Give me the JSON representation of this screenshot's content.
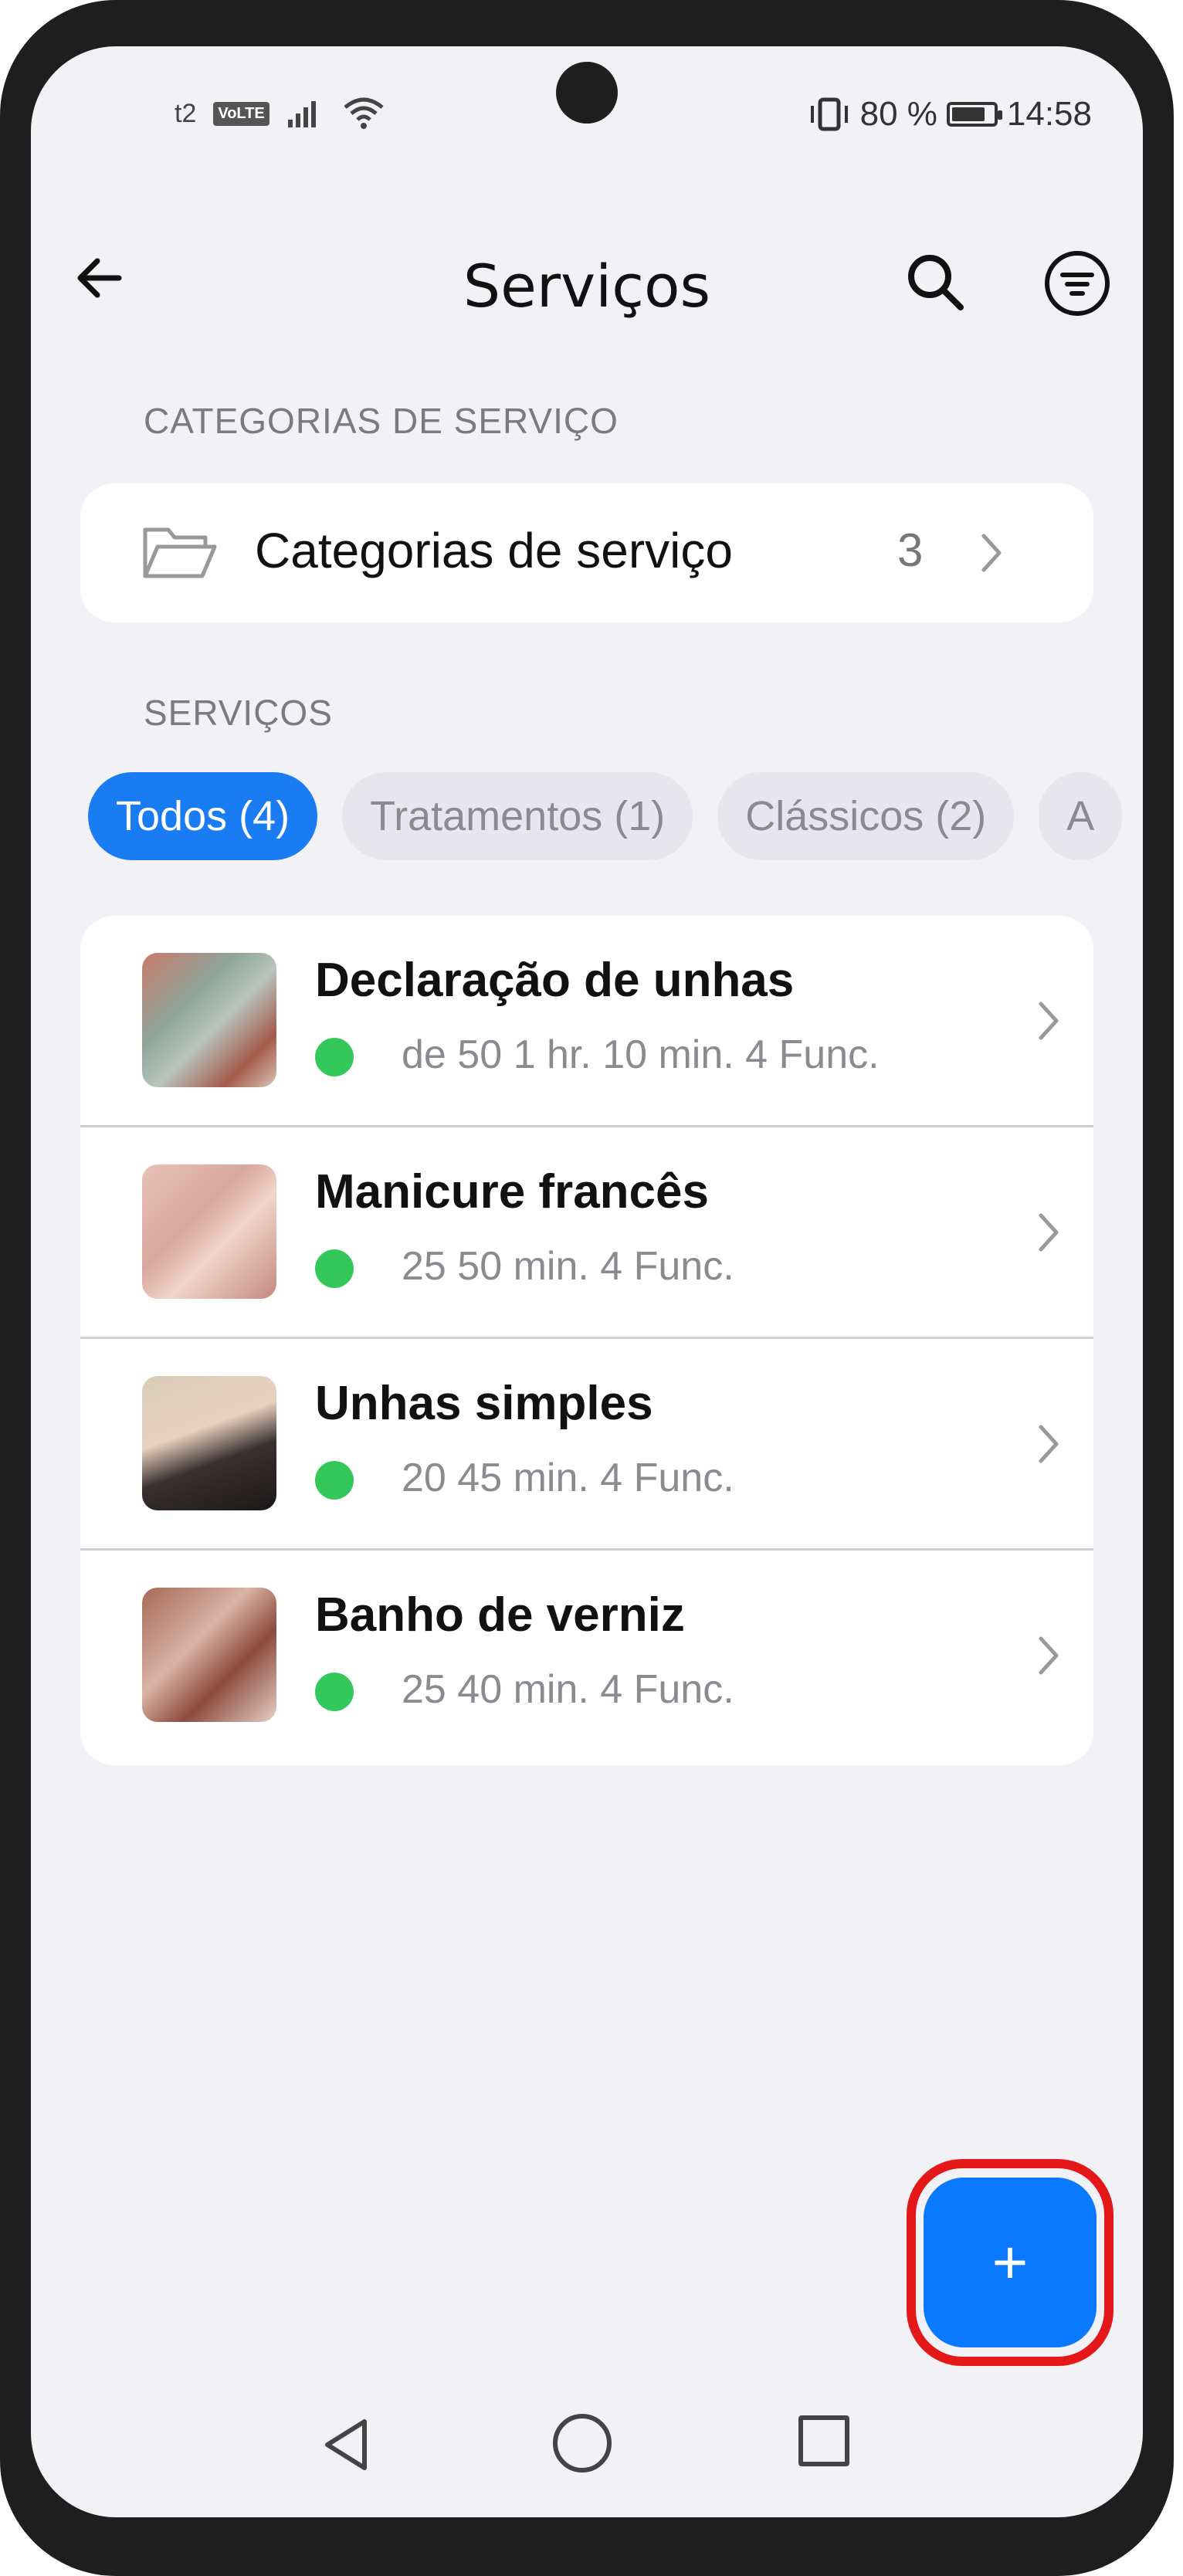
{
  "status_bar": {
    "carrier": "t2",
    "volte": "VoLTE",
    "battery_percent": "80 %",
    "time": "14:58"
  },
  "header": {
    "title": "Serviços",
    "icons": {
      "back": "arrow-left-icon",
      "search": "search-icon",
      "filter": "filter-icon"
    }
  },
  "categories_section": {
    "label": "CATEGORIAS DE SERVIÇO",
    "card": {
      "icon": "folder-icon",
      "label": "Categorias de serviço",
      "count": "3"
    }
  },
  "services_section": {
    "label": "SERVIÇOS",
    "chips": [
      {
        "label": "Todos (4)",
        "active": true
      },
      {
        "label": "Tratamentos (1)",
        "active": false
      },
      {
        "label": "Clássicos (2)",
        "active": false
      },
      {
        "label": "A",
        "active": false
      }
    ],
    "items": [
      {
        "name": "Declaração de unhas",
        "meta": "de 50 1 hr. 10 min. 4 Func.",
        "status_color": "#34c759"
      },
      {
        "name": "Manicure francês",
        "meta": "25 50 min. 4 Func.",
        "status_color": "#34c759"
      },
      {
        "name": "Unhas simples",
        "meta": "20 45 min. 4 Func.",
        "status_color": "#34c759"
      },
      {
        "name": "Banho de verniz",
        "meta": "25 40 min. 4 Func.",
        "status_color": "#34c759"
      }
    ]
  },
  "fab": {
    "label": "+",
    "icon": "plus-icon"
  },
  "colors": {
    "accent": "#1a7cf2",
    "fab": "#0a78ff",
    "highlight": "#e41818",
    "status_active": "#34c759",
    "background": "#f1f1f6"
  },
  "nav_bar": {
    "icons": [
      "nav-back-icon",
      "nav-home-icon",
      "nav-recents-icon"
    ]
  }
}
